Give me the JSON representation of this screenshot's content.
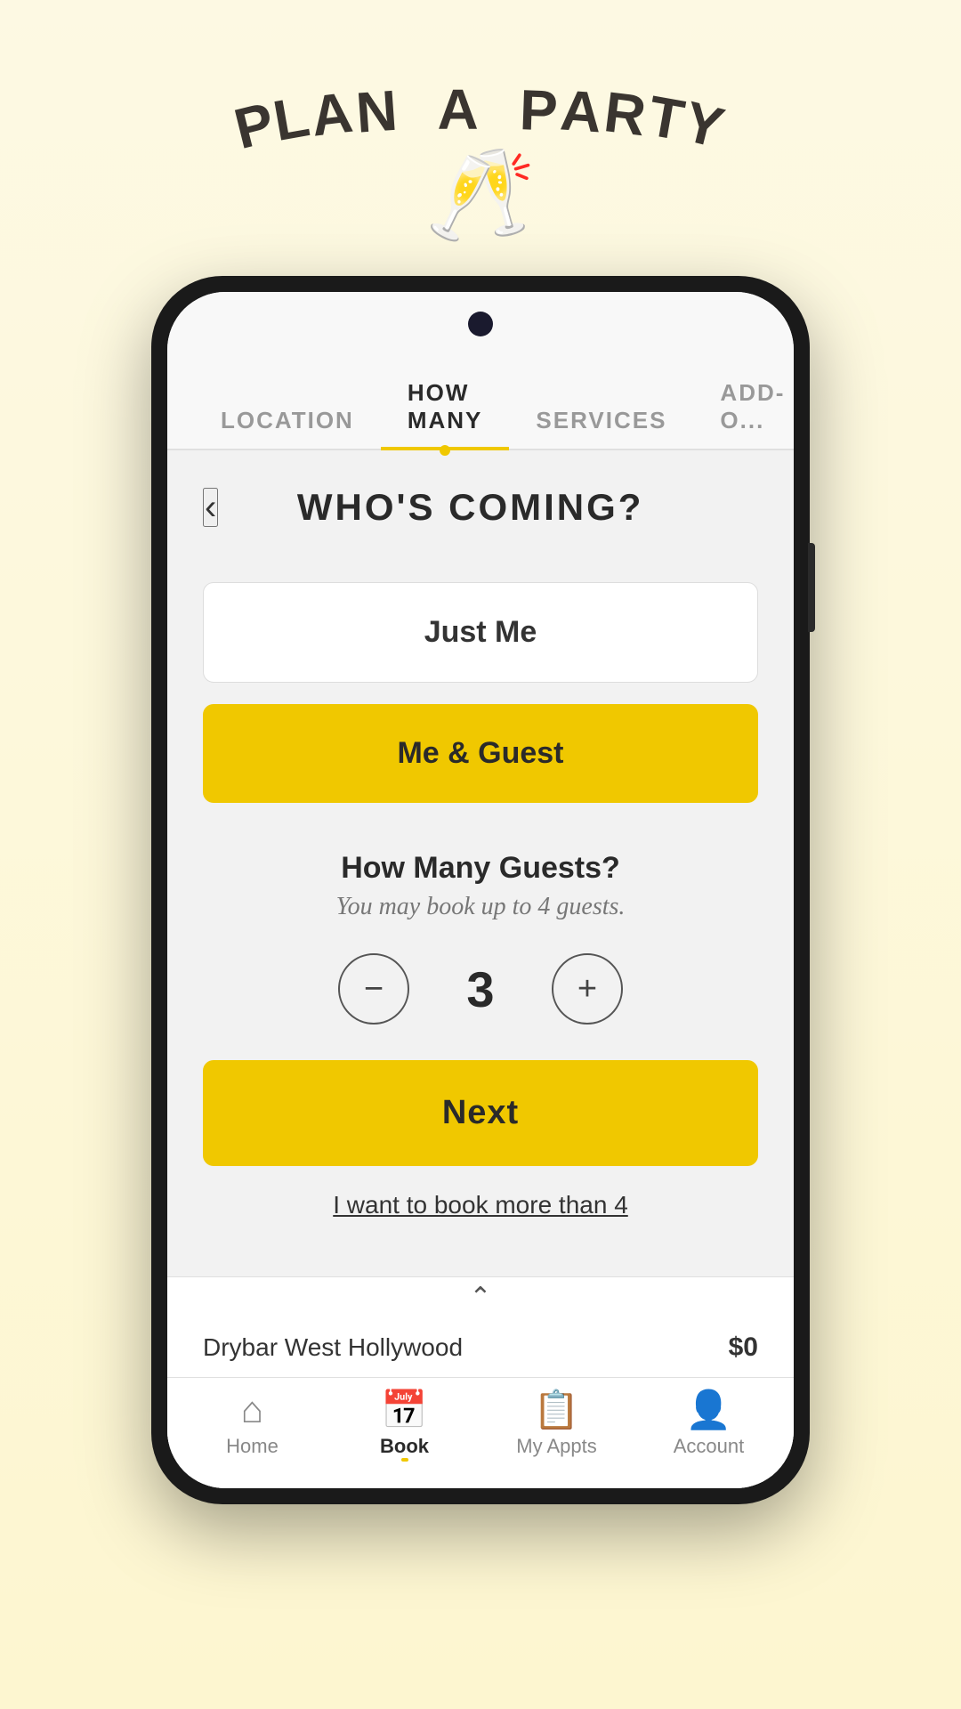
{
  "header": {
    "title_chars": [
      "P",
      "L",
      "A",
      "N",
      " ",
      "A",
      " ",
      "P",
      "A",
      "R",
      "T",
      "Y"
    ],
    "title_display": "PLAN A PARTY",
    "icon": "🥂"
  },
  "tabs": [
    {
      "id": "location",
      "label": "LOCATION",
      "active": false
    },
    {
      "id": "how-many",
      "label": "HOW MANY",
      "active": true
    },
    {
      "id": "services",
      "label": "SERVICES",
      "active": false
    },
    {
      "id": "add-ons",
      "label": "ADD-O...",
      "active": false
    }
  ],
  "page": {
    "title": "WHO'S COMING?"
  },
  "options": [
    {
      "id": "just-me",
      "label": "Just Me",
      "style": "plain"
    },
    {
      "id": "me-guest",
      "label": "Me & Guest",
      "style": "primary"
    }
  ],
  "guest_section": {
    "title": "How Many Guests?",
    "subtitle": "You may book up to 4 guests.",
    "count": "3",
    "decrement_label": "−",
    "increment_label": "+"
  },
  "next_button": {
    "label": "Next"
  },
  "more_link": {
    "label": "I want to book more than 4"
  },
  "bottom": {
    "chevron": "^",
    "location": "Drybar West Hollywood",
    "price": "$0",
    "nav": [
      {
        "id": "home",
        "icon": "⌂",
        "label": "Home",
        "active": false
      },
      {
        "id": "book",
        "icon": "📅",
        "label": "Book",
        "active": true
      },
      {
        "id": "my-appts",
        "icon": "📋",
        "label": "My Appts",
        "active": false
      },
      {
        "id": "account",
        "icon": "👤",
        "label": "Account",
        "active": false
      }
    ]
  }
}
